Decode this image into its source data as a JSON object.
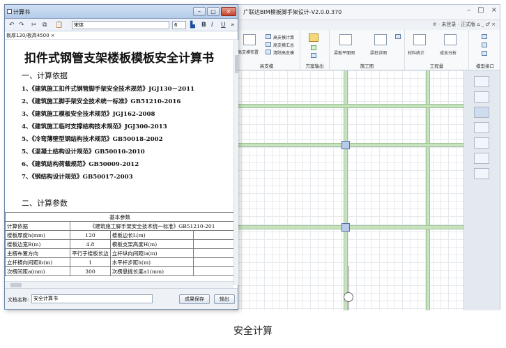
{
  "app": {
    "title": "广联达BIM模板脚手架设计-V2.0.0.370",
    "window_controls": [
      "–",
      "□",
      "×"
    ],
    "sub_bar_right": "⑦ ·  未登录 ·  正式版   ⌂ _ ♂ ×",
    "ribbon": {
      "groups": [
        {
          "label": "高支模",
          "buttons": [
            "高支模布置",
            "高支模计算",
            "高支模汇总",
            "清除高支模"
          ]
        },
        {
          "label": "方案输出",
          "buttons": []
        },
        {
          "label": "施工图",
          "buttons": [
            "梁板平面图",
            "梁柱详图"
          ]
        },
        {
          "label": "工程量",
          "buttons": [
            "材料统计",
            "成本分析"
          ]
        },
        {
          "label": "模型接口",
          "buttons": []
        }
      ]
    }
  },
  "doc": {
    "title": "计算书",
    "window_controls": [
      "–",
      "□",
      "×"
    ],
    "toolbar": {
      "icons": [
        "undo-icon",
        "redo-icon",
        "cut-icon",
        "copy-icon",
        "paste-icon"
      ],
      "font_name": "宋体",
      "font_size": "6",
      "format_buttons": [
        "B",
        "I",
        "U"
      ],
      "more": "»"
    },
    "tab": "板厚120/板高4500 ×",
    "main_title": "扣件式钢管支架楼板模板安全计算书",
    "section1": "一、计算依据",
    "basis": [
      "1、《建筑施工扣件式钢管脚手架安全技术规范》JGJ130－2011",
      "2、《建筑施工脚手架安全技术统一标准》GB51210-2016",
      "3、《建筑施工模板安全技术规范》JGJ162-2008",
      "4、《建筑施工临时支撑结构技术规范》JGJ300-2013",
      "5、《冷弯薄壁型钢结构技术规范》GB50018-2002",
      "5、《混凝土结构设计规范》GB50010-2010",
      "6、《建筑结构荷载规范》GB50009-2012",
      "7、《钢结构设计规范》GB50017-2003"
    ],
    "section2": "二、计算参数",
    "table": {
      "header": "基本参数",
      "basis_label": "计算依据",
      "basis_value": "《建筑施工脚手架安全技术统一标准》GB51210-201",
      "rows": [
        [
          "楼板厚度h(mm)",
          "120",
          "楼板边长L(m)",
          ""
        ],
        [
          "楼板边宽B(m)",
          "4.8",
          "模板支架高度H(m)",
          ""
        ],
        [
          "主楞布置方向",
          "平行于楼板长边",
          "立杆纵向间距la(m)",
          ""
        ],
        [
          "立杆横向间距lb(m)",
          "1",
          "水平杆步距h(m)",
          ""
        ],
        [
          "次楞间距a(mm)",
          "300",
          "次楞悬挑长度a1(mm)",
          ""
        ]
      ]
    },
    "footer": {
      "fname_label": "文档名称:",
      "fname_value": "安全计算书",
      "save_button": "成果保存",
      "output_button": "输出"
    }
  },
  "caption": "安全计算"
}
